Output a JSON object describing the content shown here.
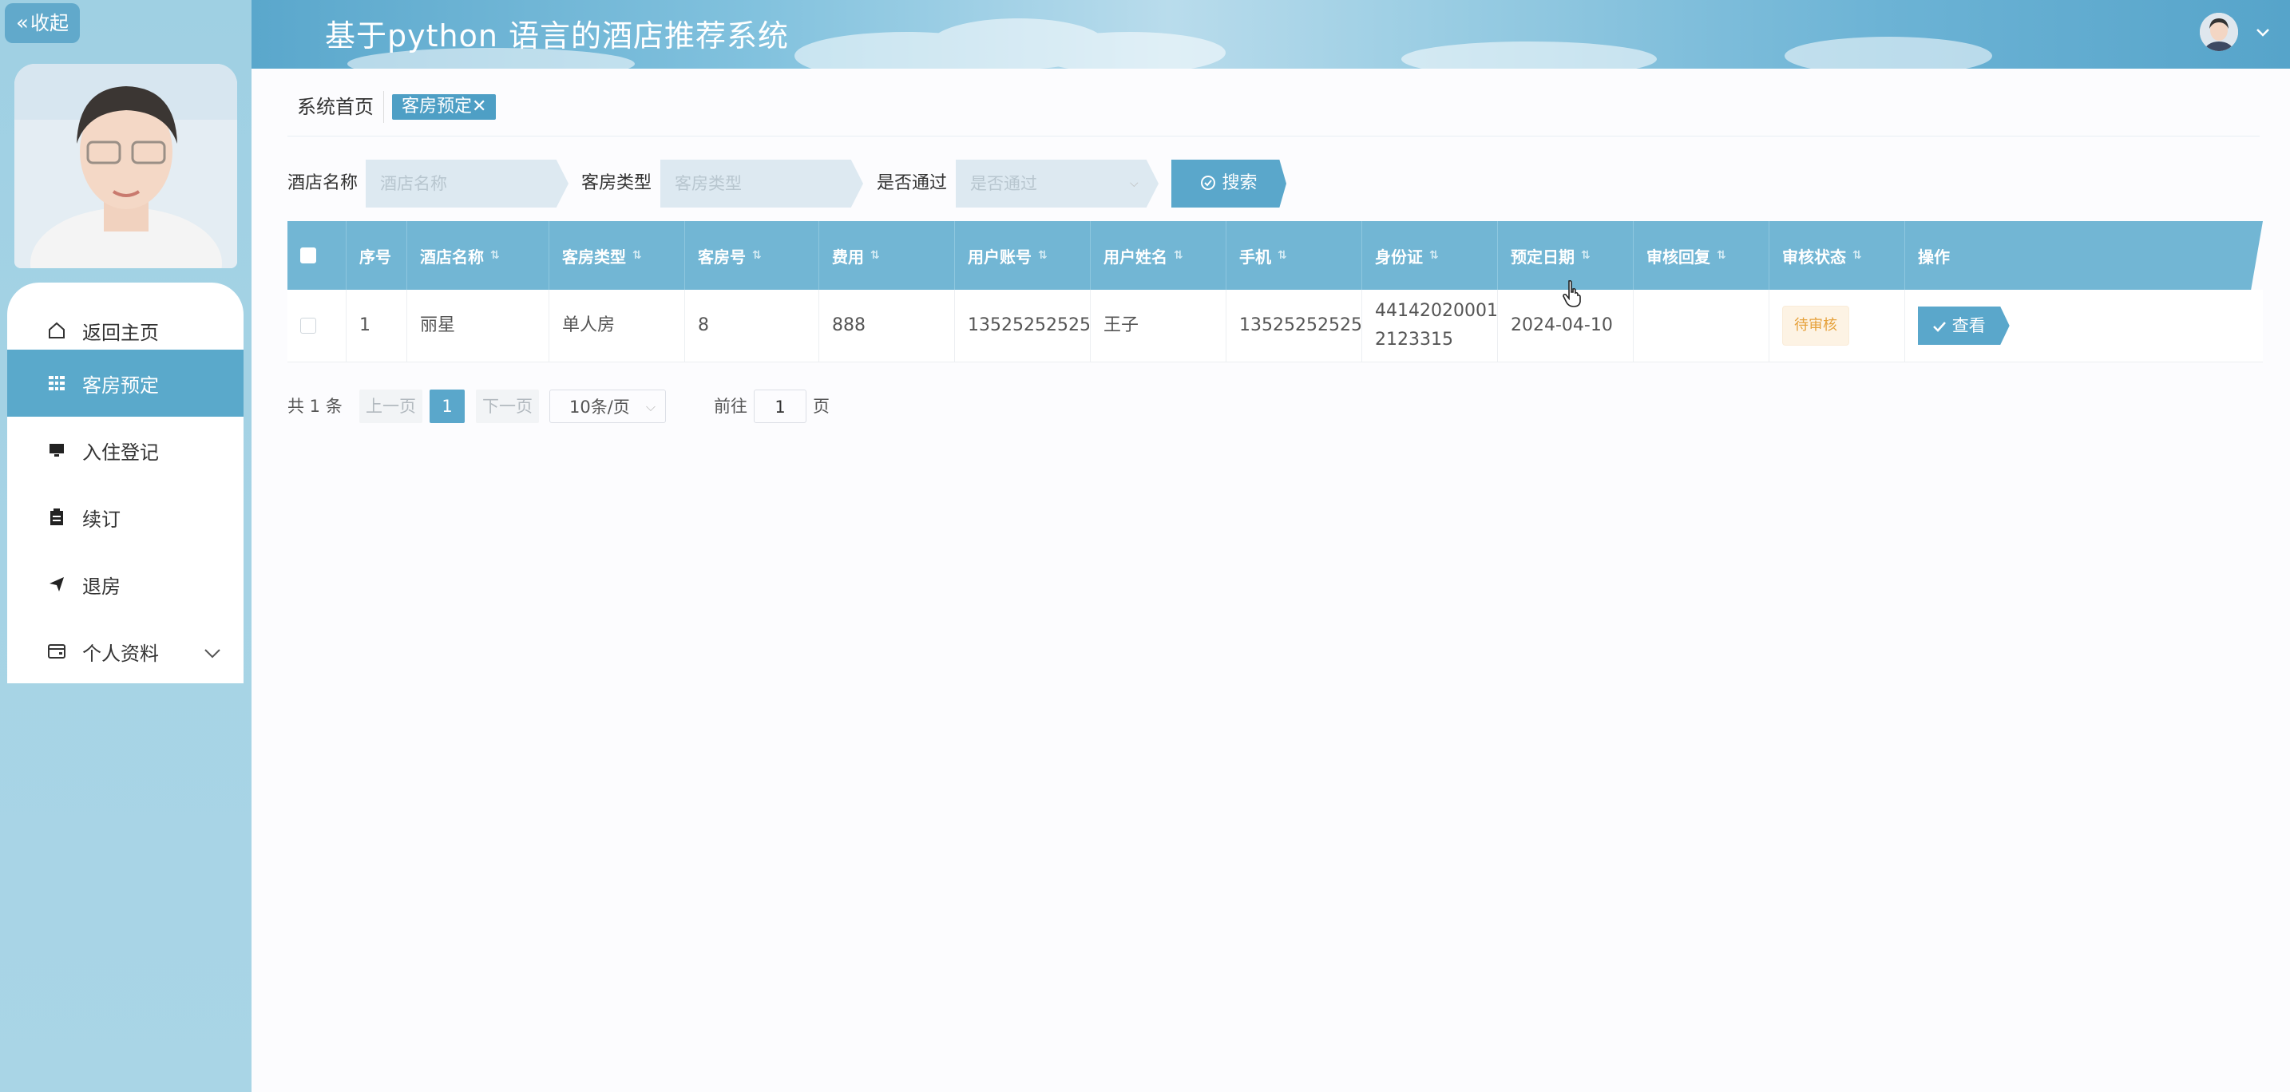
{
  "sidebar": {
    "collapse_label": "收起",
    "menu": [
      {
        "label": "返回主页",
        "icon": "home-icon"
      },
      {
        "label": "客房预定",
        "icon": "grid-icon",
        "active": true
      },
      {
        "label": "入住登记",
        "icon": "monitor-icon"
      },
      {
        "label": "续订",
        "icon": "clipboard-icon"
      },
      {
        "label": "退房",
        "icon": "send-icon"
      },
      {
        "label": "个人资料",
        "icon": "wallet-icon"
      }
    ]
  },
  "header": {
    "title": "基于python 语言的酒店推荐系统"
  },
  "tabs": {
    "home": "系统首页",
    "active": "客房预定",
    "close": "✕"
  },
  "filters": {
    "hotel_label": "酒店名称",
    "hotel_placeholder": "酒店名称",
    "room_type_label": "客房类型",
    "room_type_placeholder": "客房类型",
    "passed_label": "是否通过",
    "passed_placeholder": "是否通过",
    "search_label": "搜索"
  },
  "table": {
    "columns": [
      "序号",
      "酒店名称",
      "客房类型",
      "客房号",
      "费用",
      "用户账号",
      "用户姓名",
      "手机",
      "身份证",
      "预定日期",
      "审核回复",
      "审核状态",
      "操作"
    ],
    "rows": [
      {
        "index": "1",
        "hotel": "丽星",
        "room_type": "单人房",
        "room_no": "8",
        "fee": "888",
        "account": "13525252525",
        "name": "王子",
        "phone": "13525252525",
        "id_line1": "44142020001",
        "id_line2": "2123315",
        "date": "2024-04-10",
        "reply": "",
        "status": "待审核",
        "action": "查看"
      }
    ]
  },
  "pager": {
    "total": "共 1 条",
    "prev": "上一页",
    "current": "1",
    "next": "下一页",
    "size": "10条/页",
    "goto": "前往",
    "page_value": "1",
    "page_unit": "页"
  },
  "colors": {
    "accent": "#5aa7cb",
    "header_row": "#72b6d4",
    "sidebar": "#a6d3e5",
    "badge_text": "#e6a23c"
  }
}
